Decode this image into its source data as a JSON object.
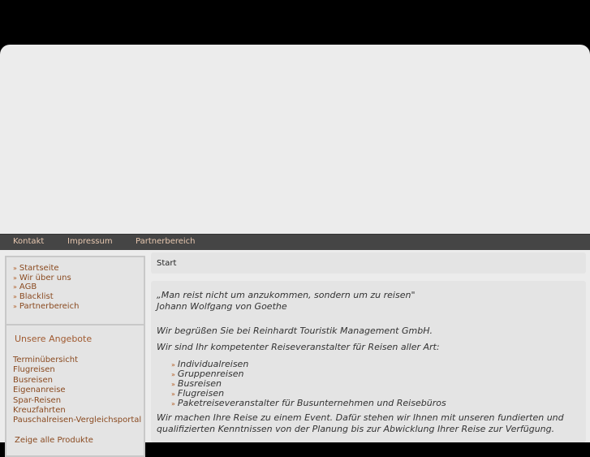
{
  "nav": [
    "Kontakt",
    "Impressum",
    "Partnerbereich"
  ],
  "sidebar": {
    "links": [
      "Startseite",
      "Wir über uns",
      "AGB",
      "Blacklist",
      "Partnerbereich"
    ],
    "angebote_title": "Unsere Angebote",
    "angebote": [
      "Terminübersicht",
      "Flugreisen",
      "Busreisen",
      "Eigenanreise",
      "Spar-Reisen",
      "Kreuzfahrten",
      "Pauschalreisen-Vergleichsportal"
    ],
    "show_all": "Zeige alle Produkte"
  },
  "breadcrumb": "Start",
  "content": {
    "quote": "„Man reist nicht um anzukommen, sondern um zu reisen\"",
    "author": "Johann Wolfgang von Goethe",
    "welcome": "Wir begrüßen Sie bei Reinhardt Touristik Management GmbH.",
    "intro": "Wir sind Ihr kompetenter Reiseveranstalter für Reisen aller Art:",
    "list": [
      "Individualreisen",
      "Gruppenreisen",
      "Busreisen",
      "Flugreisen",
      "Paketreiseveranstalter für Busunternehmen und Reisebüros"
    ],
    "event1": "Wir machen Ihre Reise zu einem Event. Dafür stehen wir Ihnen mit unseren fundierten und",
    "event2": "qualifizierten Kenntnissen von der Planung bis zur Abwicklung Ihrer Reise zur Verfügung."
  }
}
